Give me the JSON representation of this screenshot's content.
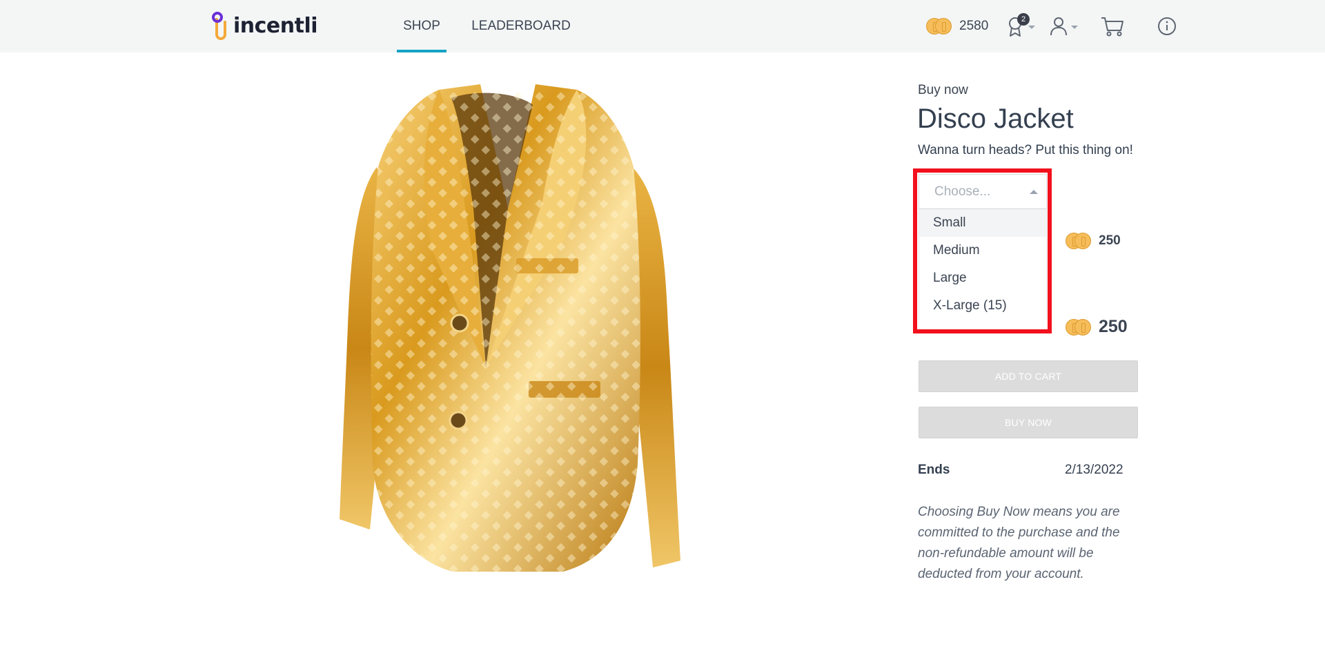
{
  "header": {
    "brand": "incentli",
    "nav": [
      {
        "label": "SHOP",
        "active": true
      },
      {
        "label": "LEADERBOARD",
        "active": false
      }
    ],
    "coin_balance": "2580",
    "awards_badge_count": "2",
    "icons": [
      "coin-icon",
      "award-icon",
      "user-icon",
      "cart-icon",
      "info-icon"
    ]
  },
  "product": {
    "image_alt": "Gold sequin disco jacket",
    "kicker": "Buy now",
    "title": "Disco Jacket",
    "subtitle": "Wanna turn heads? Put this thing on!",
    "size_select": {
      "placeholder": "Choose...",
      "options": [
        "Small",
        "Medium",
        "Large",
        "X-Large (15)"
      ],
      "highlighted_option": "Small"
    },
    "price_small": "250",
    "price_total": "250",
    "add_to_cart_label": "ADD TO CART",
    "buy_now_label": "BUY NOW",
    "ends_label": "Ends",
    "ends_date": "2/13/2022",
    "disclaimer": "Choosing Buy Now means you are committed to the purchase and the non-refundable amount will be deducted from your account."
  },
  "colors": {
    "accent": "#16a3c5",
    "coin": "#f6bd5a",
    "highlight": "#f2101c",
    "topbar_bg": "#f4f6f6"
  }
}
